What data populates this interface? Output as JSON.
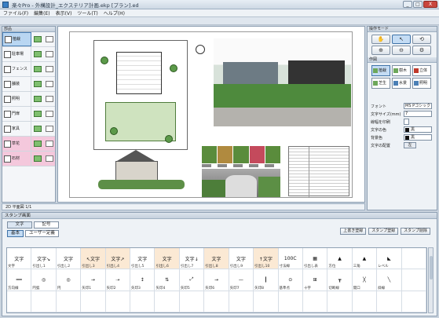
{
  "window": {
    "title": "楽々Pro - 外構設計_エクステリア計画.ekp [プラン].ed",
    "buttons": {
      "minimize": "_",
      "maximize": "□",
      "close": "X"
    }
  },
  "menu": [
    "ファイル(F)",
    "編集(E)",
    "表示(V)",
    "ツール(T)",
    "ヘルプ(H)"
  ],
  "left_palette": {
    "header": "部品",
    "items": [
      {
        "label": "植栽",
        "selected": true,
        "pink": false
      },
      {
        "label": "駐車場",
        "selected": false,
        "pink": false
      },
      {
        "label": "フェンス",
        "selected": false,
        "pink": false
      },
      {
        "label": "舗装",
        "selected": false,
        "pink": false
      },
      {
        "label": "照明",
        "selected": false,
        "pink": false
      },
      {
        "label": "門扉",
        "selected": false,
        "pink": false
      },
      {
        "label": "家具",
        "selected": false,
        "pink": false
      },
      {
        "label": "草花",
        "selected": false,
        "pink": true
      },
      {
        "label": "石材",
        "selected": false,
        "pink": true
      }
    ]
  },
  "canvas": {
    "status_text": "2D 平面図 1/1"
  },
  "right_panel": {
    "tools_header": "操作モード",
    "tools": [
      "✋",
      "↖",
      "⟲",
      "⊕",
      "⊖",
      "⚙"
    ],
    "tools_selected_index": 1,
    "parts_header": "作図",
    "parts": [
      {
        "label": "植栽",
        "color": "g"
      },
      {
        "label": "樹木",
        "color": "g"
      },
      {
        "label": "立体",
        "color": "r"
      },
      {
        "label": "芝生",
        "color": "g"
      },
      {
        "label": "水景",
        "color": "b"
      },
      {
        "label": "照明",
        "color": "b"
      }
    ],
    "parts_selected_index": 0,
    "props": [
      {
        "label": "フォント",
        "value": "MS Pゴシック",
        "type": "select"
      },
      {
        "label": "文字サイズ(mm)",
        "value": "7",
        "type": "select"
      },
      {
        "label": "線幅を印刷",
        "value": "",
        "type": "check"
      },
      {
        "label": "文字の色",
        "value": "黒",
        "type": "swatch"
      },
      {
        "label": "背景色",
        "value": "黒",
        "type": "swatch"
      },
      {
        "label": "文字の配置",
        "value": "左",
        "type": "button"
      }
    ]
  },
  "stamp_panel": {
    "header": "スタンプ画面",
    "tabs": [
      "文字",
      "記号"
    ],
    "tabs_selected_index": 0,
    "subtabs": [
      "基本",
      "ユーザー定義"
    ],
    "subtabs_selected_index": 0,
    "actions": [
      "上書き登録",
      "スタンプ登録",
      "スタンプ削除"
    ],
    "stamps": [
      {
        "text": "文字",
        "cap": "文字",
        "hl": false
      },
      {
        "text": "文字↘",
        "cap": "引出し1",
        "hl": false
      },
      {
        "text": "文字",
        "cap": "引出し2",
        "hl": false
      },
      {
        "text": "↖文字",
        "cap": "引出し3",
        "hl": true
      },
      {
        "text": "文字↗",
        "cap": "引出し4",
        "hl": true
      },
      {
        "text": "文字",
        "cap": "引出し5",
        "hl": false
      },
      {
        "text": "文字",
        "cap": "引出し6",
        "hl": true
      },
      {
        "text": "文字↓",
        "cap": "引出し7",
        "hl": false
      },
      {
        "text": "文字",
        "cap": "引出し8",
        "hl": true
      },
      {
        "text": "文字",
        "cap": "引出し9",
        "hl": false
      },
      {
        "text": "↑文字",
        "cap": "引出し10",
        "hl": true
      },
      {
        "text": "100C",
        "cap": "寸法線",
        "hl": false
      },
      {
        "text": "▦",
        "cap": "引出し表",
        "hl": false
      },
      {
        "text": "▲",
        "cap": "方位",
        "hl": false
      },
      {
        "text": "▲",
        "cap": "三角",
        "hl": false
      },
      {
        "text": "◣",
        "cap": "レベル",
        "hl": false
      },
      {
        "text": "",
        "cap": "",
        "hl": false
      },
      {
        "text": "━━",
        "cap": "方向線",
        "hl": false
      },
      {
        "text": "◎",
        "cap": "円弧",
        "hl": false
      },
      {
        "text": "◎",
        "cap": "円",
        "hl": false
      },
      {
        "text": "→",
        "cap": "矢印1",
        "hl": false
      },
      {
        "text": "⇢",
        "cap": "矢印2",
        "hl": false
      },
      {
        "text": "↕",
        "cap": "矢印3",
        "hl": false
      },
      {
        "text": "⇅",
        "cap": "矢印4",
        "hl": false
      },
      {
        "text": "⤢",
        "cap": "矢印5",
        "hl": false
      },
      {
        "text": "→",
        "cap": "矢印6",
        "hl": false
      },
      {
        "text": "—",
        "cap": "矢印7",
        "hl": false
      },
      {
        "text": "┃",
        "cap": "矢印8",
        "hl": false
      },
      {
        "text": "⊙",
        "cap": "基準点",
        "hl": false
      },
      {
        "text": "⊞",
        "cap": "十字",
        "hl": false
      },
      {
        "text": "┳",
        "cap": "切断線",
        "hl": false
      },
      {
        "text": "╳",
        "cap": "開口",
        "hl": false
      },
      {
        "text": "╲",
        "cap": "斜線",
        "hl": false
      },
      {
        "text": "",
        "cap": "",
        "hl": false
      },
      {
        "text": "",
        "cap": "",
        "hl": false
      },
      {
        "text": "",
        "cap": "",
        "hl": false
      },
      {
        "text": "",
        "cap": "",
        "hl": false
      },
      {
        "text": "",
        "cap": "",
        "hl": false
      },
      {
        "text": "",
        "cap": "",
        "hl": false
      },
      {
        "text": "",
        "cap": "",
        "hl": false
      },
      {
        "text": "",
        "cap": "",
        "hl": false
      },
      {
        "text": "",
        "cap": "",
        "hl": false
      },
      {
        "text": "",
        "cap": "",
        "hl": false
      },
      {
        "text": "",
        "cap": "",
        "hl": false
      },
      {
        "text": "",
        "cap": "",
        "hl": false
      },
      {
        "text": "",
        "cap": "",
        "hl": false
      },
      {
        "text": "",
        "cap": "",
        "hl": false
      },
      {
        "text": "",
        "cap": "",
        "hl": false
      },
      {
        "text": "",
        "cap": "",
        "hl": false
      },
      {
        "text": "",
        "cap": "",
        "hl": false
      },
      {
        "text": "",
        "cap": "",
        "hl": false
      }
    ]
  }
}
